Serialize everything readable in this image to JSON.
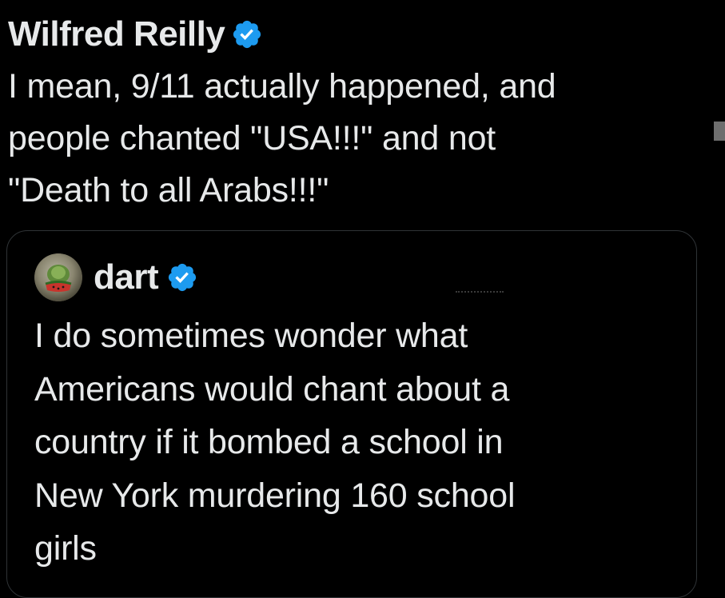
{
  "tweet": {
    "author_name": "Wilfred Reilly",
    "verified_icon": "verified-badge-icon",
    "text": "I mean, 9/11 actually happened, and\npeople chanted \"USA!!!\" and not\n\"Death to all Arabs!!!\""
  },
  "quoted_tweet": {
    "author_name": "dart",
    "avatar_icon": "avatar",
    "verified_icon": "verified-badge-icon",
    "text": "I do sometimes wonder what\nAmericans would chant about a\ncountry if it bombed a school in\nNew York murdering 160 school\ngirls"
  },
  "colors": {
    "background": "#000000",
    "text": "#e7e9ea",
    "verified_blue": "#1d9bf0",
    "card_border": "#2f3336"
  }
}
